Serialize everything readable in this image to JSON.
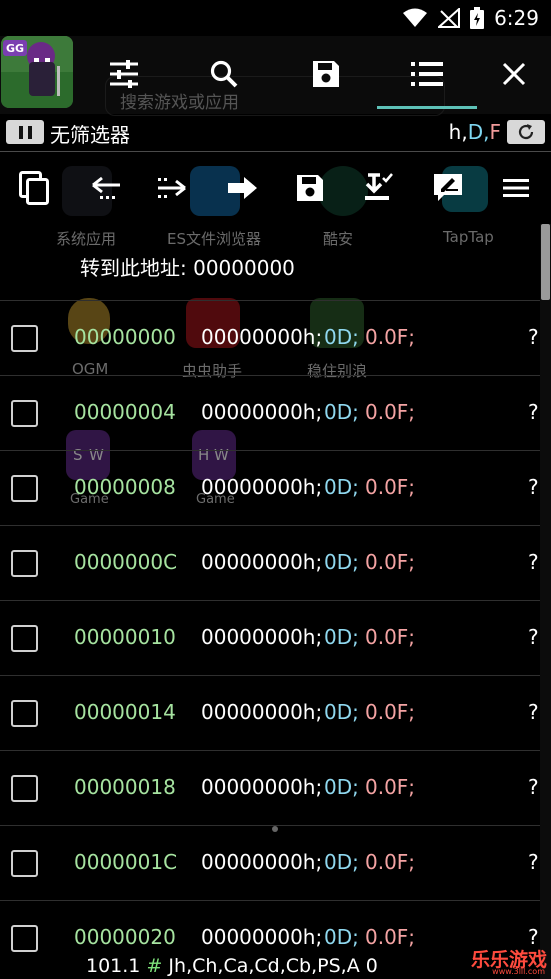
{
  "status_bar": {
    "time": "6:29"
  },
  "toolbar": {
    "app_name": "GG",
    "search_placeholder": "搜索游戏或应用"
  },
  "launcher_ghost": {
    "apps": [
      "系统应用",
      "ES文件浏览器",
      "酷安",
      "TapTap",
      "OGM",
      "虫虫助手",
      "稳住别浪",
      "Game",
      "Game"
    ],
    "icon_letters": [
      "S",
      "W",
      "H",
      "W"
    ]
  },
  "filter": {
    "label": "无筛选器",
    "flag_h": "h,",
    "flag_d": "D,",
    "flag_f": "F"
  },
  "goto": {
    "label": "转到此地址:  00000000"
  },
  "memory_rows": [
    {
      "address": "00000000",
      "hex": "00000000h;",
      "dword": "0D;",
      "float": "0.0F;",
      "tail": "?"
    },
    {
      "address": "00000004",
      "hex": "00000000h;",
      "dword": "0D;",
      "float": "0.0F;",
      "tail": "?"
    },
    {
      "address": "00000008",
      "hex": "00000000h;",
      "dword": "0D;",
      "float": "0.0F;",
      "tail": "?"
    },
    {
      "address": "0000000C",
      "hex": "00000000h;",
      "dword": "0D;",
      "float": "0.0F;",
      "tail": "?"
    },
    {
      "address": "00000010",
      "hex": "00000000h;",
      "dword": "0D;",
      "float": "0.0F;",
      "tail": "?"
    },
    {
      "address": "00000014",
      "hex": "00000000h;",
      "dword": "0D;",
      "float": "0.0F;",
      "tail": "?"
    },
    {
      "address": "00000018",
      "hex": "00000000h;",
      "dword": "0D;",
      "float": "0.0F;",
      "tail": "?"
    },
    {
      "address": "0000001C",
      "hex": "00000000h;",
      "dword": "0D;",
      "float": "0.0F;",
      "tail": "?"
    },
    {
      "address": "00000020",
      "hex": "00000000h;",
      "dword": "0D;",
      "float": "0.0F;",
      "tail": "?"
    }
  ],
  "bottom_status": {
    "version": "101.1",
    "hash": "#",
    "registers": "Jh,Ch,Ca,Cd,Cb,PS,A 0"
  },
  "watermark": {
    "title": "乐乐游戏",
    "url": "www.3lll.com"
  },
  "colors": {
    "address": "#a6e3a0",
    "dword": "#8fd8ef",
    "float": "#f4a3a3",
    "accent_tab": "#5ec2b8"
  },
  "icons": [
    "wifi-icon",
    "signal-icon",
    "battery-icon",
    "settings-sliders-icon",
    "search-icon",
    "save-icon",
    "list-icon",
    "close-icon",
    "copy-icon",
    "goto-back-icon",
    "goto-forward-icon",
    "save-list-icon",
    "download-icon",
    "edit-icon",
    "menu-icon",
    "refresh-icon"
  ]
}
